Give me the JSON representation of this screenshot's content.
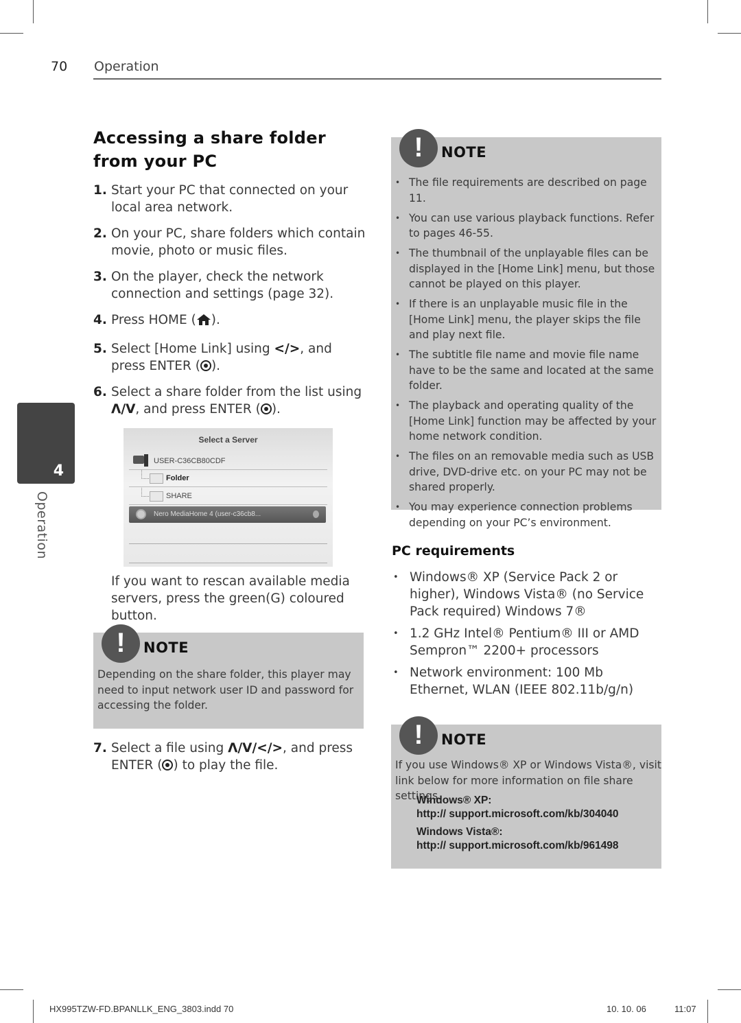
{
  "header": {
    "page_number": "70",
    "section": "Operation"
  },
  "title": "Accessing a share folder from your PC",
  "steps": [
    {
      "num": "1.",
      "text": "Start your PC that connected on your local area network."
    },
    {
      "num": "2.",
      "text": "On your PC, share folders which contain movie, photo or music files."
    },
    {
      "num": "3.",
      "text": "On the player, check the network connection and settings (page 32)."
    },
    {
      "num": "4.",
      "before": "Press HOME (",
      "after": ")."
    },
    {
      "num": "5.",
      "before": "Select [Home Link] using ",
      "arrows": "</>",
      "middle": ", and press ENTER (",
      "after": ")."
    },
    {
      "num": "6.",
      "before": "Select a share folder from the list using ",
      "arrows": "Λ/V",
      "middle": ", and press ENTER (",
      "after": ")."
    },
    {
      "num": "7.",
      "before": "Select a file using ",
      "arrows": "Λ/V/</>",
      "middle": ", and press ENTER (",
      "after": ") to play the file."
    }
  ],
  "screenshot": {
    "title": "Select a Server",
    "server": "USER-C36CB80CDF",
    "folders": [
      "Folder",
      "SHARE"
    ],
    "selected": "Nero MediaHome 4 (user-c36cb8..."
  },
  "rescan_text": "If you want to rescan available media servers, press the green(G) coloured button.",
  "note_left": {
    "badge": "!",
    "title": "NOTE",
    "text": "Depending on the share folder, this player may need to input network user ID and password for accessing the folder."
  },
  "note_right_top": {
    "badge": "!",
    "title": "NOTE",
    "items": [
      "The file requirements are described on page 11.",
      "You can use various playback functions. Refer to pages 46-55.",
      "The thumbnail of the unplayable files can be displayed in the [Home Link] menu, but those cannot be played on this player.",
      "If there is an unplayable music file in the [Home Link] menu, the player skips the file and play next file.",
      "The subtitle file name and movie file name have to be the same and located at the same folder.",
      "The playback and operating quality of the [Home Link] function may be affected by your home network condition.",
      "The files on an removable media such as USB drive, DVD-drive etc. on your PC may not be shared properly.",
      "You may experience connection problems depending on your PC’s environment."
    ]
  },
  "pc_requirements": {
    "title": "PC requirements",
    "items": [
      "Windows® XP (Service Pack 2 or higher), Windows Vista® (no Service Pack required) Windows 7®",
      "1.2 GHz Intel® Pentium® III or AMD Sempron™ 2200+ processors",
      "Network environment: 100 Mb Ethernet, WLAN (IEEE 802.11b/g/n)"
    ]
  },
  "note_right_bottom": {
    "badge": "!",
    "title": "NOTE",
    "text": "If you use Windows® XP or Windows Vista®, visit link below for more information on file share settings.",
    "links": [
      {
        "label": "Windows® XP:",
        "url": "http:// support.microsoft.com/kb/304040"
      },
      {
        "label": "Windows Vista®:",
        "url": "http:// support.microsoft.com/kb/961498"
      }
    ]
  },
  "side_tab": {
    "number": "4",
    "label": "Operation"
  },
  "footer": {
    "file": "HX995TZW-FD.BPANLLK_ENG_3803.indd   70",
    "date": "10. 10. 06",
    "time": "11:07"
  }
}
